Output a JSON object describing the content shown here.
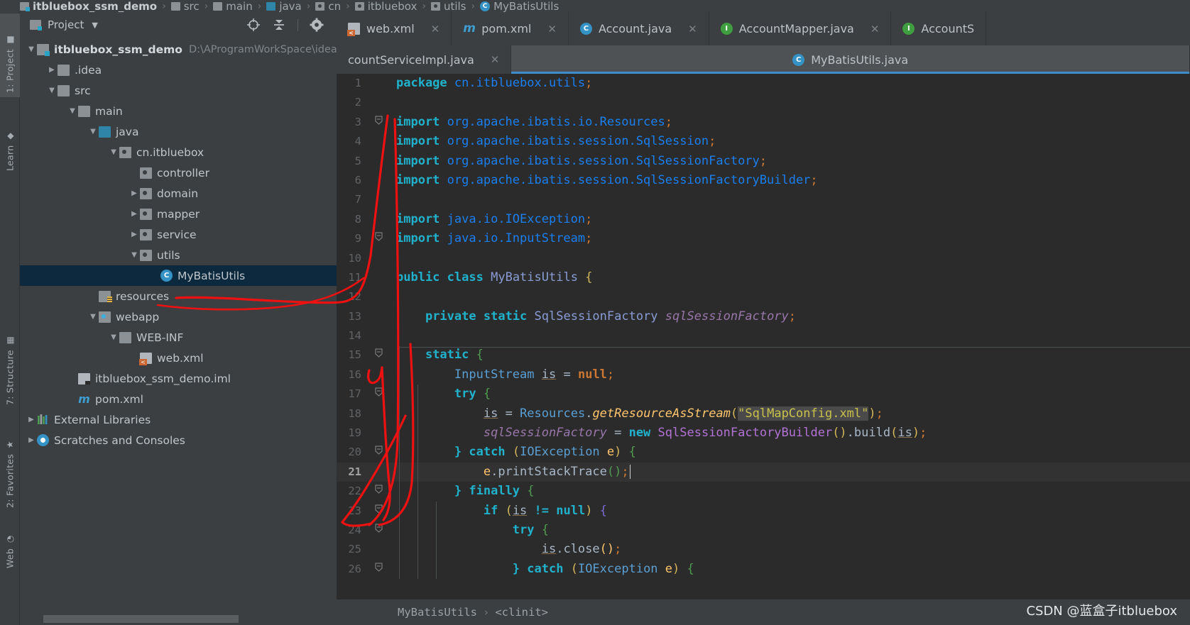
{
  "breadcrumb": {
    "items": [
      {
        "label": "itbluebox_ssm_demo",
        "icon": "folder-module-icon",
        "bold": true
      },
      {
        "label": "src",
        "icon": "folder-icon",
        "bold": false
      },
      {
        "label": "main",
        "icon": "folder-icon",
        "bold": false
      },
      {
        "label": "java",
        "icon": "folder-source-icon",
        "bold": false
      },
      {
        "label": "cn",
        "icon": "package-icon",
        "bold": false
      },
      {
        "label": "itbluebox",
        "icon": "package-icon",
        "bold": false
      },
      {
        "label": "utils",
        "icon": "package-icon",
        "bold": false
      },
      {
        "label": "MyBatisUtils",
        "icon": "class-icon",
        "bold": false
      }
    ],
    "separator": "›"
  },
  "tool_strip": {
    "items": [
      {
        "label": "1: Project",
        "icon": "project-folder-icon",
        "active": true
      },
      {
        "label": "Learn",
        "icon": "learn-icon",
        "active": false
      },
      {
        "label": "7: Structure",
        "icon": "structure-icon",
        "active": false
      },
      {
        "label": "2: Favorites",
        "icon": "star-icon",
        "active": false
      },
      {
        "label": "Web",
        "icon": "web-icon",
        "active": false
      }
    ]
  },
  "project_panel": {
    "title": "Project",
    "dropdown_glyph": "▼",
    "toolbar_icons": [
      {
        "name": "locate-target-icon"
      },
      {
        "name": "collapse-all-icon"
      },
      {
        "name": "settings-gear-icon"
      },
      {
        "name": "minimize-icon"
      }
    ],
    "tree": [
      {
        "indent": 0,
        "arrow": "▼",
        "icon": "folder-module-icon",
        "label": "itbluebox_ssm_demo",
        "bold": true,
        "path": "D:\\AProgramWorkSpace\\idea\\practice\\itbluebox_ssm_demo",
        "selected": false
      },
      {
        "indent": 1,
        "arrow": "▶",
        "icon": "folder-icon",
        "label": ".idea",
        "bold": false,
        "path": "",
        "selected": false
      },
      {
        "indent": 1,
        "arrow": "▼",
        "icon": "folder-icon",
        "label": "src",
        "bold": false,
        "path": "",
        "selected": false
      },
      {
        "indent": 2,
        "arrow": "▼",
        "icon": "folder-icon",
        "label": "main",
        "bold": false,
        "path": "",
        "selected": false
      },
      {
        "indent": 3,
        "arrow": "▼",
        "icon": "folder-source-icon",
        "label": "java",
        "bold": false,
        "path": "",
        "selected": false
      },
      {
        "indent": 4,
        "arrow": "▼",
        "icon": "package-icon",
        "label": "cn.itbluebox",
        "bold": false,
        "path": "",
        "selected": false
      },
      {
        "indent": 5,
        "arrow": "",
        "icon": "package-icon",
        "label": "controller",
        "bold": false,
        "path": "",
        "selected": false
      },
      {
        "indent": 5,
        "arrow": "▶",
        "icon": "package-icon",
        "label": "domain",
        "bold": false,
        "path": "",
        "selected": false
      },
      {
        "indent": 5,
        "arrow": "▶",
        "icon": "package-icon",
        "label": "mapper",
        "bold": false,
        "path": "",
        "selected": false
      },
      {
        "indent": 5,
        "arrow": "▶",
        "icon": "package-icon",
        "label": "service",
        "bold": false,
        "path": "",
        "selected": false
      },
      {
        "indent": 5,
        "arrow": "▼",
        "icon": "package-icon",
        "label": "utils",
        "bold": false,
        "path": "",
        "selected": false
      },
      {
        "indent": 6,
        "arrow": "",
        "icon": "class-icon",
        "label": "MyBatisUtils",
        "bold": false,
        "path": "",
        "selected": true
      },
      {
        "indent": 3,
        "arrow": "",
        "icon": "folder-resources-icon",
        "label": "resources",
        "bold": false,
        "path": "",
        "selected": false
      },
      {
        "indent": 3,
        "arrow": "▼",
        "icon": "folder-webapp-icon",
        "label": "webapp",
        "bold": false,
        "path": "",
        "selected": false
      },
      {
        "indent": 4,
        "arrow": "▼",
        "icon": "folder-icon",
        "label": "WEB-INF",
        "bold": false,
        "path": "",
        "selected": false
      },
      {
        "indent": 5,
        "arrow": "",
        "icon": "xml-file-icon",
        "label": "web.xml",
        "bold": false,
        "path": "",
        "selected": false
      },
      {
        "indent": 2,
        "arrow": "",
        "icon": "iml-file-icon",
        "label": "itbluebox_ssm_demo.iml",
        "bold": false,
        "path": "",
        "selected": false
      },
      {
        "indent": 2,
        "arrow": "",
        "icon": "maven-file-icon",
        "label": "pom.xml",
        "bold": false,
        "path": "",
        "selected": false
      },
      {
        "indent": 0,
        "arrow": "▶",
        "icon": "libraries-icon",
        "label": "External Libraries",
        "bold": false,
        "path": "",
        "selected": false
      },
      {
        "indent": 0,
        "arrow": "▶",
        "icon": "scratches-icon",
        "label": "Scratches and Consoles",
        "bold": false,
        "path": "",
        "selected": false
      }
    ]
  },
  "editor": {
    "tabs_row1": [
      {
        "label": "web.xml",
        "icon": "xml-file-icon",
        "active": false,
        "closable": true
      },
      {
        "label": "pom.xml",
        "icon": "maven-file-icon",
        "active": false,
        "closable": true
      },
      {
        "label": "Account.java",
        "icon": "class-icon",
        "active": false,
        "closable": true
      },
      {
        "label": "AccountMapper.java",
        "icon": "interface-icon",
        "active": false,
        "closable": true
      },
      {
        "label": "AccountS",
        "icon": "interface-icon",
        "active": false,
        "closable": false
      }
    ],
    "tabs_row2": [
      {
        "label": "countServiceImpl.java",
        "icon": "",
        "active": false,
        "closable": true
      },
      {
        "label": "MyBatisUtils.java",
        "icon": "class-icon",
        "active": true,
        "closable": false
      }
    ],
    "close_glyph": "✕",
    "lines": [
      {
        "n": 1,
        "fold": "",
        "current": false
      },
      {
        "n": 2,
        "fold": "",
        "current": false
      },
      {
        "n": 3,
        "fold": "-",
        "current": false
      },
      {
        "n": 4,
        "fold": "",
        "current": false
      },
      {
        "n": 5,
        "fold": "",
        "current": false
      },
      {
        "n": 6,
        "fold": "",
        "current": false
      },
      {
        "n": 7,
        "fold": "",
        "current": false
      },
      {
        "n": 8,
        "fold": "",
        "current": false
      },
      {
        "n": 9,
        "fold": "-",
        "current": false
      },
      {
        "n": 10,
        "fold": "",
        "current": false
      },
      {
        "n": 11,
        "fold": "",
        "current": false
      },
      {
        "n": 12,
        "fold": "",
        "current": false
      },
      {
        "n": 13,
        "fold": "",
        "current": false
      },
      {
        "n": 14,
        "fold": "",
        "current": false
      },
      {
        "n": 15,
        "fold": "-",
        "current": false
      },
      {
        "n": 16,
        "fold": "",
        "current": false
      },
      {
        "n": 17,
        "fold": "-",
        "current": false
      },
      {
        "n": 18,
        "fold": "",
        "current": false
      },
      {
        "n": 19,
        "fold": "",
        "current": false
      },
      {
        "n": 20,
        "fold": "-",
        "current": false
      },
      {
        "n": 21,
        "fold": "",
        "current": true
      },
      {
        "n": 22,
        "fold": "-",
        "current": false
      },
      {
        "n": 23,
        "fold": "-",
        "current": false
      },
      {
        "n": 24,
        "fold": "-",
        "current": false
      },
      {
        "n": 25,
        "fold": "",
        "current": false
      },
      {
        "n": 26,
        "fold": "-",
        "current": false
      }
    ],
    "source_text": [
      "package cn.itbluebox.utils;",
      "",
      "import org.apache.ibatis.io.Resources;",
      "import org.apache.ibatis.session.SqlSession;",
      "import org.apache.ibatis.session.SqlSessionFactory;",
      "import org.apache.ibatis.session.SqlSessionFactoryBuilder;",
      "",
      "import java.io.IOException;",
      "import java.io.InputStream;",
      "",
      "public class MyBatisUtils {",
      "",
      "    private static SqlSessionFactory sqlSessionFactory;",
      "",
      "    static {",
      "        InputStream is = null;",
      "        try {",
      "            is = Resources.getResourceAsStream(\"SqlMapConfig.xml\");",
      "            sqlSessionFactory = new SqlSessionFactoryBuilder().build(is);",
      "        } catch (IOException e) {",
      "            e.printStackTrace();",
      "        } finally {",
      "            if (is != null) {",
      "                try {",
      "                    is.close();",
      "                } catch (IOException e) {"
    ],
    "status_breadcrumb": {
      "class": "MyBatisUtils",
      "separator": "›",
      "member": "<clinit>"
    }
  },
  "watermark": "CSDN @蓝盒子itbluebox",
  "colors": {
    "panel_bg": "#3c3f41",
    "editor_bg": "#2b2b2b",
    "selection_bg": "#0d293e",
    "accent_blue": "#3d8ec9",
    "annotation_red": "#ee1111",
    "keyword_orange": "#cc7832",
    "string_green": "#6a8759",
    "field_purple": "#9876aa",
    "method_yellow": "#ffc66d"
  }
}
